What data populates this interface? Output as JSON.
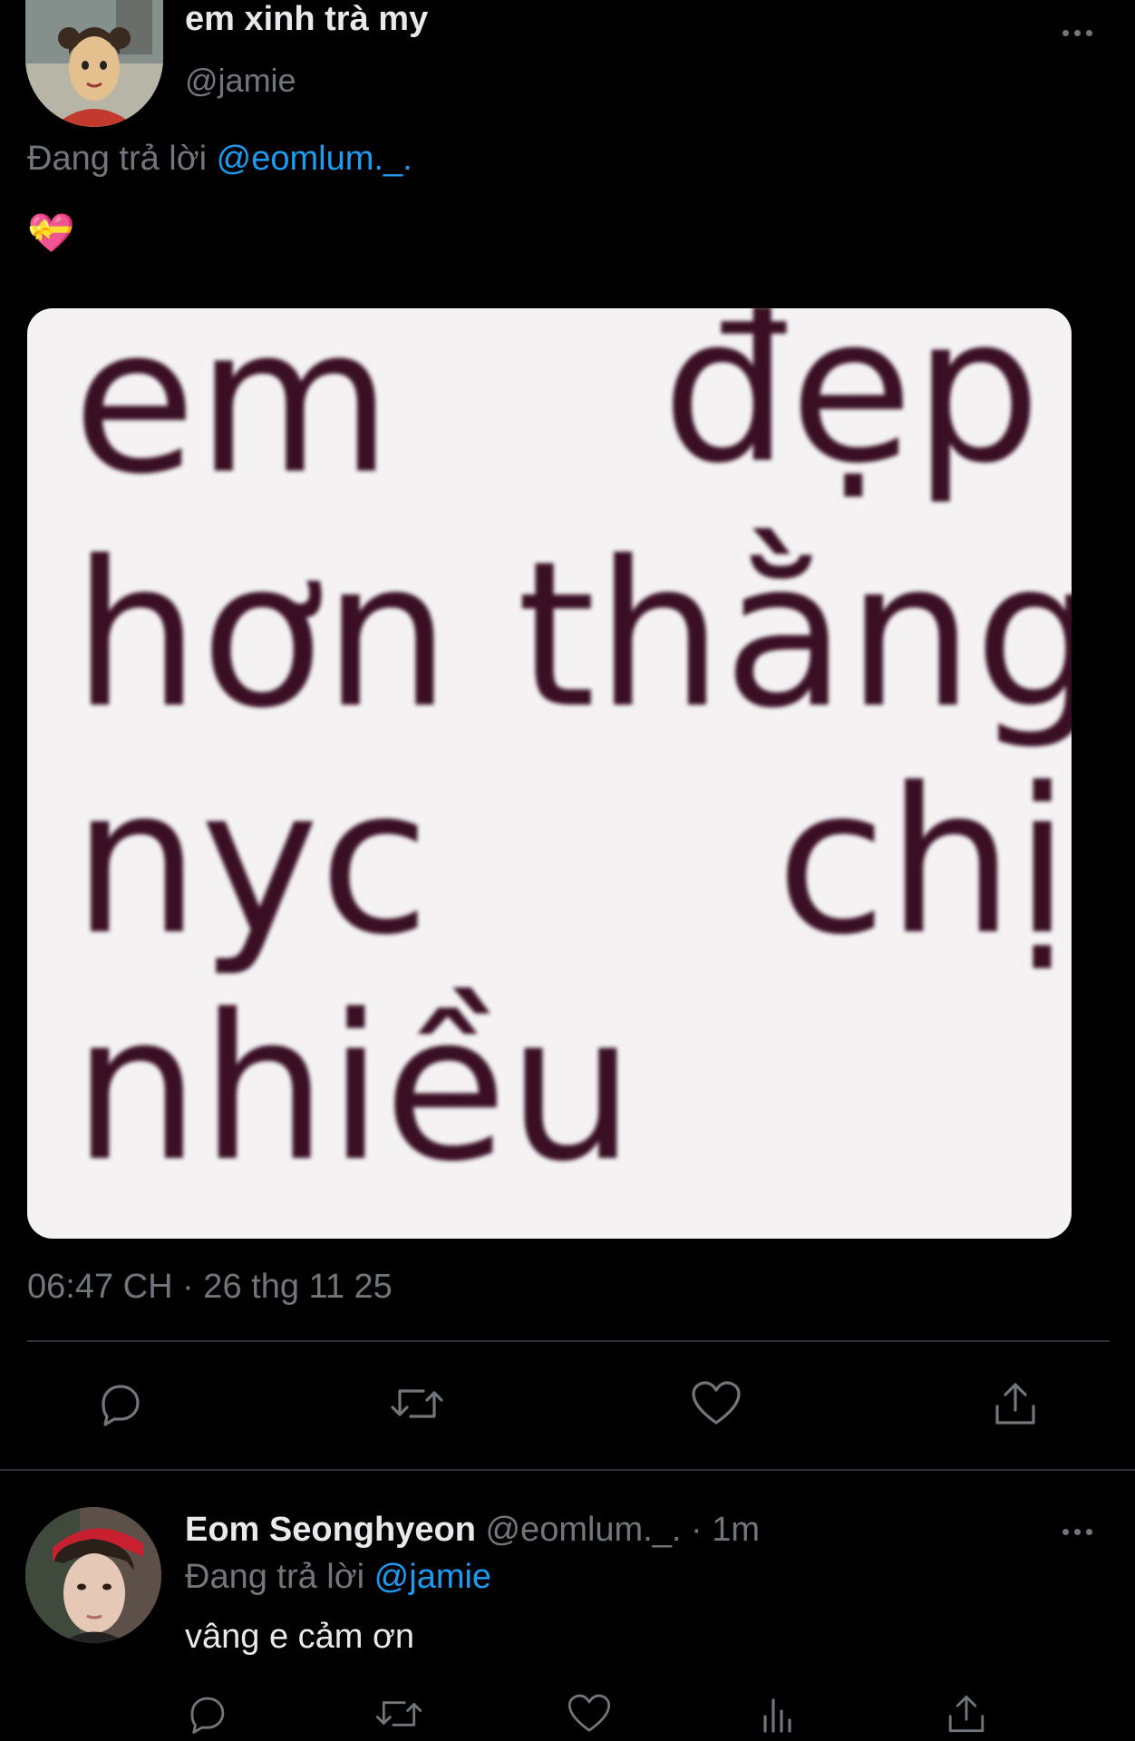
{
  "tweet": {
    "author_name": "em xinh trà my",
    "author_handle": "@jamie",
    "reply_prefix": "Đang trả lời",
    "reply_to": "@eomlum._.",
    "emoji": "💝",
    "media_text": {
      "line1_left": "em",
      "line1_right": "đẹp",
      "line2_left": "hơn",
      "line2_right": "thằng",
      "line3_left": "nyc",
      "line3_right": "chị",
      "line4_left": "nhiều"
    },
    "timestamp": "06:47 CH · 26 thg 11 25"
  },
  "reply": {
    "author_name": "Eom Seonghyeon",
    "author_handle": "@eomlum._.",
    "time": "· 1m",
    "reply_prefix": "Đang trả lời",
    "reply_to": "@jamie",
    "text": "vâng e cảm ơn"
  },
  "icons": {
    "more": "more-dots-icon",
    "reply": "reply-bubble-icon",
    "retweet": "retweet-icon",
    "like": "heart-icon",
    "views": "views-bar-icon",
    "share": "share-icon"
  },
  "colors": {
    "background": "#000000",
    "text": "#e7e9ea",
    "muted": "#71767b",
    "link": "#1d9bf0",
    "divider": "#2f3336"
  }
}
